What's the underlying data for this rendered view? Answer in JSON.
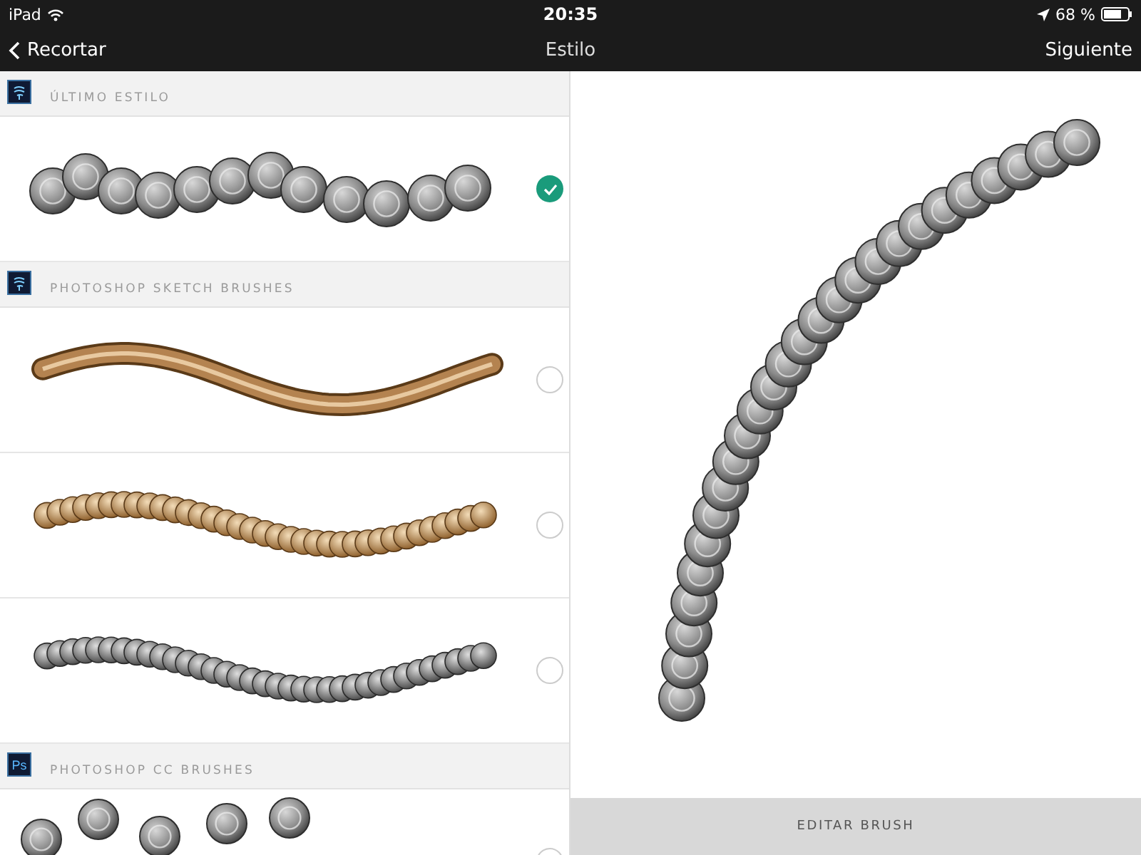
{
  "status_bar": {
    "device": "iPad",
    "time": "20:35",
    "battery": "68 %"
  },
  "nav_bar": {
    "back": "Recortar",
    "title": "Estilo",
    "next": "Siguiente"
  },
  "sections": [
    {
      "title": "ÚLTIMO ESTILO",
      "icon": {
        "kind": "sketch"
      },
      "brushes": [
        {
          "kind": "coins",
          "selected": true
        }
      ]
    },
    {
      "title": "PHOTOSHOP SKETCH BRUSHES",
      "icon": {
        "kind": "sketch"
      },
      "brushes": [
        {
          "kind": "ribbon",
          "selected": false
        },
        {
          "kind": "chain-gold",
          "selected": false
        },
        {
          "kind": "chain-silver",
          "selected": false
        }
      ]
    },
    {
      "title": "PHOTOSHOP CC BRUSHES",
      "icon": {
        "kind": "ps",
        "text": "Ps"
      },
      "brushes": [
        {
          "kind": "scatter",
          "selected": false
        }
      ]
    }
  ],
  "action_button": "EDITAR BRUSH"
}
